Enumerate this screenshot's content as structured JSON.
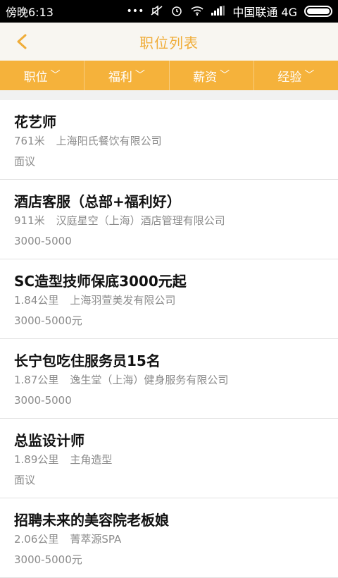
{
  "status_bar": {
    "time": "傍晚6:13",
    "carrier": "中国联通 4G"
  },
  "header": {
    "title": "职位列表"
  },
  "filters": [
    {
      "label": "职位"
    },
    {
      "label": "福利"
    },
    {
      "label": "薪资"
    },
    {
      "label": "经验"
    }
  ],
  "jobs": [
    {
      "title": "花艺师",
      "distance": "761米",
      "company": "上海阳氏餐饮有限公司",
      "salary": "面议"
    },
    {
      "title": "酒店客服（总部+福利好）",
      "distance": "911米",
      "company": "汉庭星空（上海）酒店管理有限公司",
      "salary": "3000-5000"
    },
    {
      "title": "SC造型技师保底3000元起",
      "distance": "1.84公里",
      "company": "上海羽萱美发有限公司",
      "salary": "3000-5000元"
    },
    {
      "title": "长宁包吃住服务员15名",
      "distance": "1.87公里",
      "company": "逸生堂（上海）健身服务有限公司",
      "salary": "3000-5000"
    },
    {
      "title": "总监设计师",
      "distance": "1.89公里",
      "company": "主角造型",
      "salary": "面议"
    },
    {
      "title": "招聘未来的美容院老板娘",
      "distance": "2.06公里",
      "company": "菁萃源SPA",
      "salary": "3000-5000元"
    }
  ],
  "colors": {
    "accent": "#f5b23b",
    "title_color": "#f0ad39"
  }
}
